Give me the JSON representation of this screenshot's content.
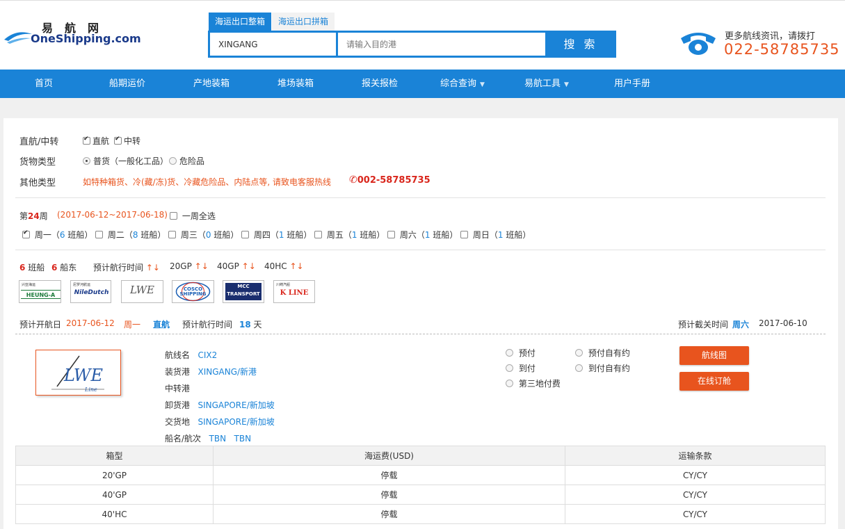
{
  "header": {
    "logo_cn": "易航网",
    "logo_en": "OneShipping.com",
    "tabs": [
      "海运出口整箱",
      "海运出口拼箱"
    ],
    "origin_value": "XINGANG",
    "dest_placeholder": "请输入目的港",
    "search_label": "搜 索",
    "hotline_label": "更多航线资讯，请拨打",
    "hotline_number": "022-58785735"
  },
  "nav": {
    "items": [
      "首页",
      "船期运价",
      "产地装箱",
      "堆场装箱",
      "报关报检",
      "综合查询",
      "易航工具",
      "用户手册"
    ]
  },
  "filters": {
    "route_label": "直航/中转",
    "route_opts": [
      "直航",
      "中转"
    ],
    "cargo_label": "货物类型",
    "cargo_opts": [
      "普货（一般化工品）",
      "危险品"
    ],
    "other_label": "其他类型",
    "other_text": "如特种箱货、冷(藏/冻)货、冷藏危险品、内陆点等, 请致电客服热线",
    "other_phone": "002-58785735"
  },
  "week": {
    "prefix": "第",
    "num": "24",
    "suffix": "周",
    "range": "(2017-06-12~2017-06-18)",
    "select_all": "一周全选",
    "days": [
      {
        "name": "周一",
        "count": "6",
        "unit": "班船"
      },
      {
        "name": "周二",
        "count": "8",
        "unit": "班船"
      },
      {
        "name": "周三",
        "count": "0",
        "unit": "班船"
      },
      {
        "name": "周四",
        "count": "1",
        "unit": "班船"
      },
      {
        "name": "周五",
        "count": "1",
        "unit": "班船"
      },
      {
        "name": "周六",
        "count": "1",
        "unit": "班船"
      },
      {
        "name": "周日",
        "count": "1",
        "unit": "班船"
      }
    ]
  },
  "summary": {
    "voyages_num": "6",
    "voyages_label": "班船",
    "carriers_num": "6",
    "carriers_label": "船东",
    "sort_transit": "预计航行时间",
    "sort_20gp": "20GP",
    "sort_40gp": "40GP",
    "sort_40hc": "40HC",
    "sort_arrows": "↑↓"
  },
  "carriers": [
    {
      "name": "HEUNG-A",
      "tag": "兴亚海运"
    },
    {
      "name": "NileDutch",
      "tag": "尼罗河航运"
    },
    {
      "name": "LWE",
      "tag": ""
    },
    {
      "name": "COSCO SHIPPING",
      "tag": ""
    },
    {
      "name": "MCC TRANSPORT",
      "tag": ""
    },
    {
      "name": "K LINE",
      "tag": "川崎汽船"
    }
  ],
  "sailing": {
    "etd_label": "预计开航日",
    "etd_date": "2017-06-12",
    "etd_day": "周一",
    "route_type": "直航",
    "transit_label": "预计航行时间",
    "transit_days": "18",
    "transit_unit": "天",
    "cutoff_label": "预计截关时间",
    "cutoff_day": "周六",
    "cutoff_date": "2017-06-10"
  },
  "detail": {
    "carrier_logo": "LWE",
    "carrier_logo_sub": "Line",
    "fields": [
      {
        "label": "航线名",
        "value": "CIX2"
      },
      {
        "label": "装货港",
        "value": "XINGANG/新港"
      },
      {
        "label": "中转港",
        "value": ""
      },
      {
        "label": "卸货港",
        "value": "SINGAPORE/新加坡"
      },
      {
        "label": "交货地",
        "value": "SINGAPORE/新加坡"
      },
      {
        "label": "船名/航次",
        "value": "TBN",
        "value2": "TBN"
      }
    ],
    "payment_opts": [
      "预付",
      "预付自有约",
      "到付",
      "到付自有约",
      "第三地付费"
    ],
    "route_map_btn": "航线图",
    "book_btn": "在线订舱"
  },
  "rates": {
    "headers": [
      "箱型",
      "海运费(USD)",
      "运输条款"
    ],
    "rows": [
      [
        "20'GP",
        "停载",
        "CY/CY"
      ],
      [
        "40'GP",
        "停载",
        "CY/CY"
      ],
      [
        "40'HC",
        "停载",
        "CY/CY"
      ]
    ]
  },
  "colors": {
    "brand_blue": "#1a83d7",
    "accent_orange": "#e8541e",
    "highlight_red": "#d9261c"
  }
}
